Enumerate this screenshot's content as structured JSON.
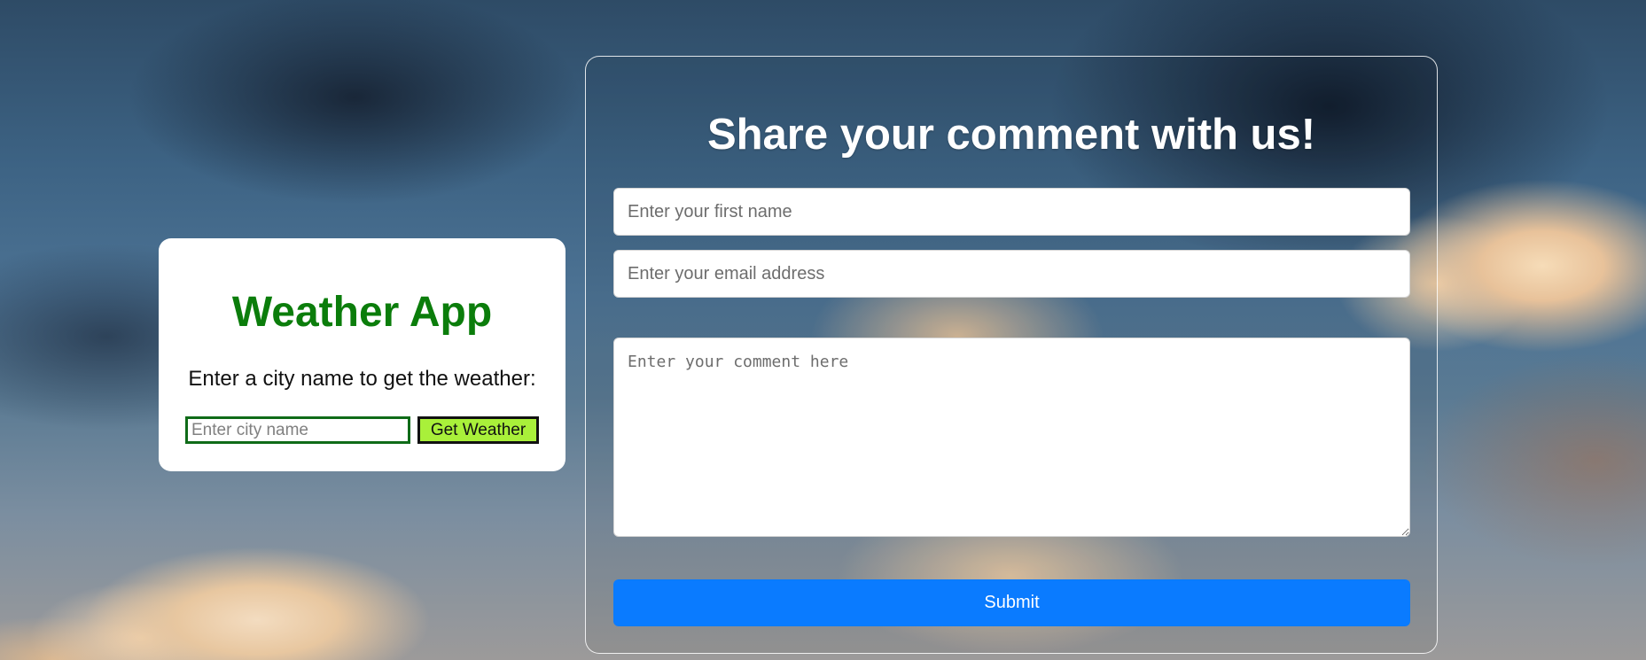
{
  "weather": {
    "title": "Weather App",
    "prompt": "Enter a city name to get the weather:",
    "city_placeholder": "Enter city name",
    "button_label": "Get Weather"
  },
  "comment_form": {
    "title": "Share your comment with us!",
    "first_name_placeholder": "Enter your first name",
    "email_placeholder": "Enter your email address",
    "comment_placeholder": "Enter your comment here",
    "submit_label": "Submit"
  },
  "colors": {
    "weather_title": "#0b7d0b",
    "weather_button": "#a9f03a",
    "submit_button": "#0a7bff"
  }
}
